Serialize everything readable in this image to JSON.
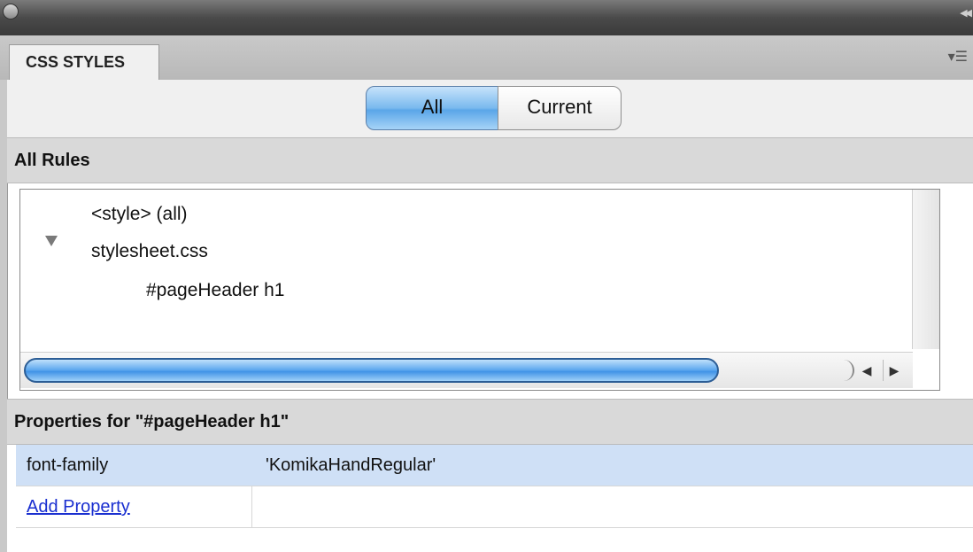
{
  "panel": {
    "tab_label": "CSS STYLES",
    "icons": {
      "window": "circle-button-icon",
      "collapse": "double-chevron-icon",
      "menu": "panel-menu-icon"
    }
  },
  "mode_toggle": {
    "all_label": "All",
    "current_label": "Current",
    "selected": "All"
  },
  "rules_section": {
    "title": "All Rules",
    "tree": [
      {
        "label": "<style> (all)",
        "expanded": false
      },
      {
        "label": "stylesheet.css",
        "expanded": true
      },
      {
        "label": "#pageHeader h1",
        "indent": 2
      }
    ]
  },
  "properties_section": {
    "title": "Properties for \"#pageHeader h1\"",
    "rows": [
      {
        "name": "font-family",
        "value": "'KomikaHandRegular'",
        "selected": true
      }
    ],
    "add_property_label": "Add Property"
  },
  "colors": {
    "selection": "#cfe0f6",
    "accent_blue": "#5aa6e8",
    "link": "#1a2fd0"
  }
}
